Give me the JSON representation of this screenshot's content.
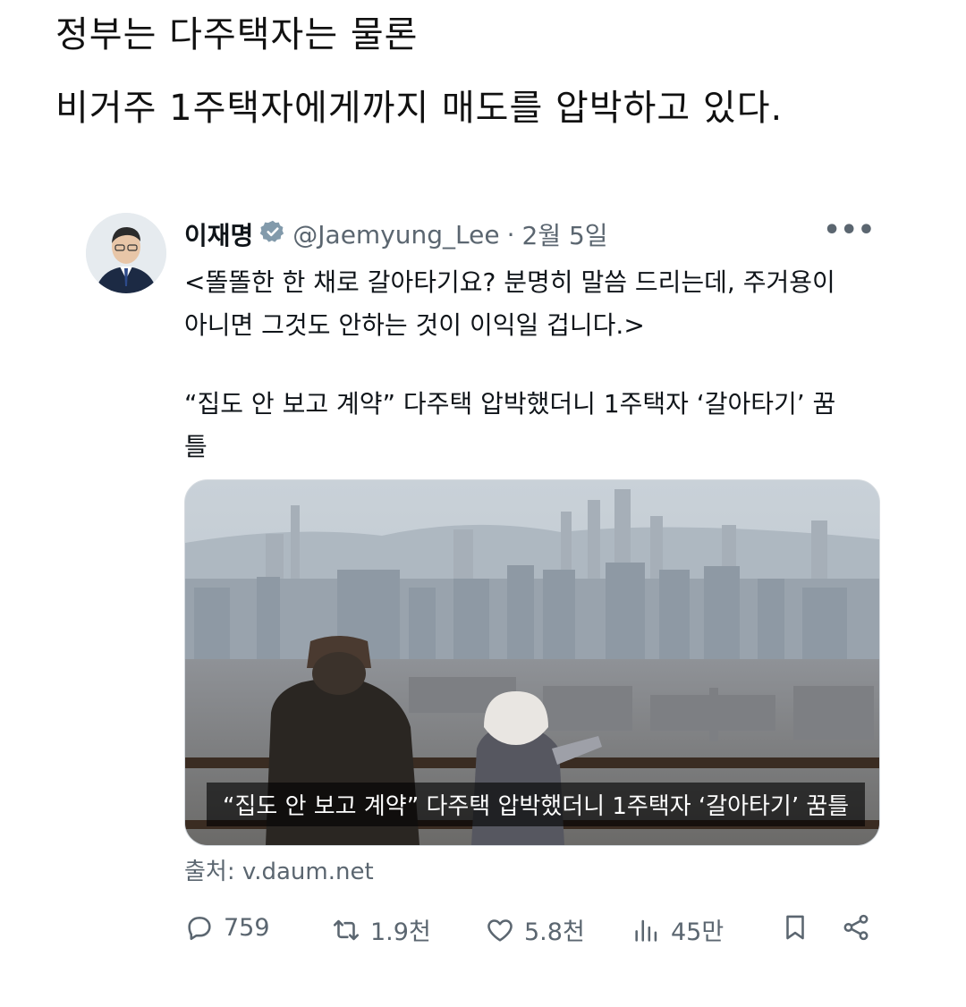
{
  "caption": {
    "line1": "정부는 다주택자는 물론",
    "line2": "비거주 1주택자에게까지 매도를 압박하고 있다."
  },
  "tweet": {
    "name": "이재명",
    "handle": "@Jaemyung_Lee",
    "separator": "·",
    "date": "2월 5일",
    "text_line1": "<똘똘한 한 채로 갈아타기요? 분명히 말씀 드리는데, 주거용이",
    "text_line2": "아니면 그것도 안하는 것이 이익일 겁니다.>",
    "quote_line1": "“집도 안 보고 계약” 다주택 압박했더니 1주택자 ‘갈아타기’ 꿈",
    "quote_line2": "틀",
    "card": {
      "title": "“집도 안 보고 계약” 다주택 압박했더니 1주택자 ‘갈아타기’ 꿈틀",
      "source": "출처: v.daum.net"
    },
    "stats": {
      "replies": "759",
      "retweets": "1.9천",
      "likes": "5.8천",
      "views": "45만"
    }
  },
  "colors": {
    "text": "#0f1419",
    "secondary": "#5b6670",
    "verified": "#829aab"
  }
}
